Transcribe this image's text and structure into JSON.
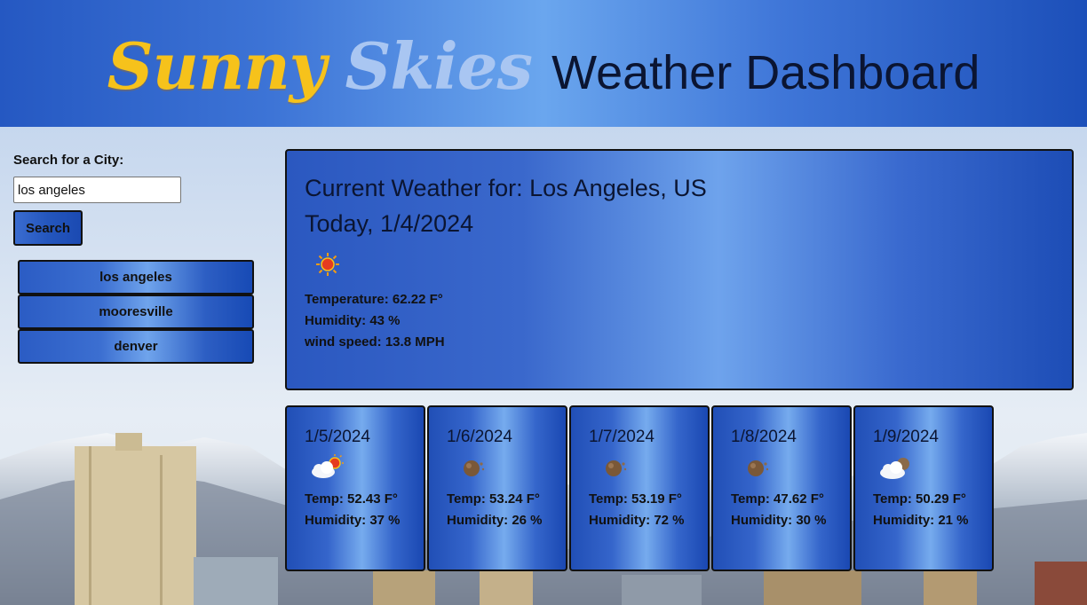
{
  "header": {
    "brand_part1": "Sunny",
    "brand_part2": "Skies",
    "title_rest": "Weather Dashboard"
  },
  "sidebar": {
    "search_label": "Search for a City:",
    "search_value": "los angeles",
    "search_button": "Search",
    "history": [
      "los angeles",
      "mooresville",
      "denver"
    ]
  },
  "current": {
    "title_label": "Current Weather for:",
    "location": "Los Angeles, US",
    "date_line": "Today, 1/4/2024",
    "icon": "sun-icon",
    "temperature": "Temperature: 62.22 F°",
    "humidity": "Humidity: 43 %",
    "wind": "wind speed: 13.8 MPH"
  },
  "forecast": [
    {
      "date": "1/5/2024",
      "icon": "partly-cloudy-sun-icon",
      "temp": "Temp: 52.43 F°",
      "humidity": "Humidity: 37 %"
    },
    {
      "date": "1/6/2024",
      "icon": "moon-clouds-icon",
      "temp": "Temp: 53.24 F°",
      "humidity": "Humidity: 26 %"
    },
    {
      "date": "1/7/2024",
      "icon": "moon-clouds-icon",
      "temp": "Temp: 53.19 F°",
      "humidity": "Humidity: 72 %"
    },
    {
      "date": "1/8/2024",
      "icon": "moon-clouds-icon",
      "temp": "Temp: 47.62 F°",
      "humidity": "Humidity: 30 %"
    },
    {
      "date": "1/9/2024",
      "icon": "cloudy-icon",
      "temp": "Temp: 50.29 F°",
      "humidity": "Humidity: 21 %"
    }
  ],
  "colors": {
    "brand_yellow": "#f6c21b",
    "brand_light_blue": "#a9c6f2",
    "panel_blue": "#3a68cc",
    "text_dark": "#0b1532"
  }
}
